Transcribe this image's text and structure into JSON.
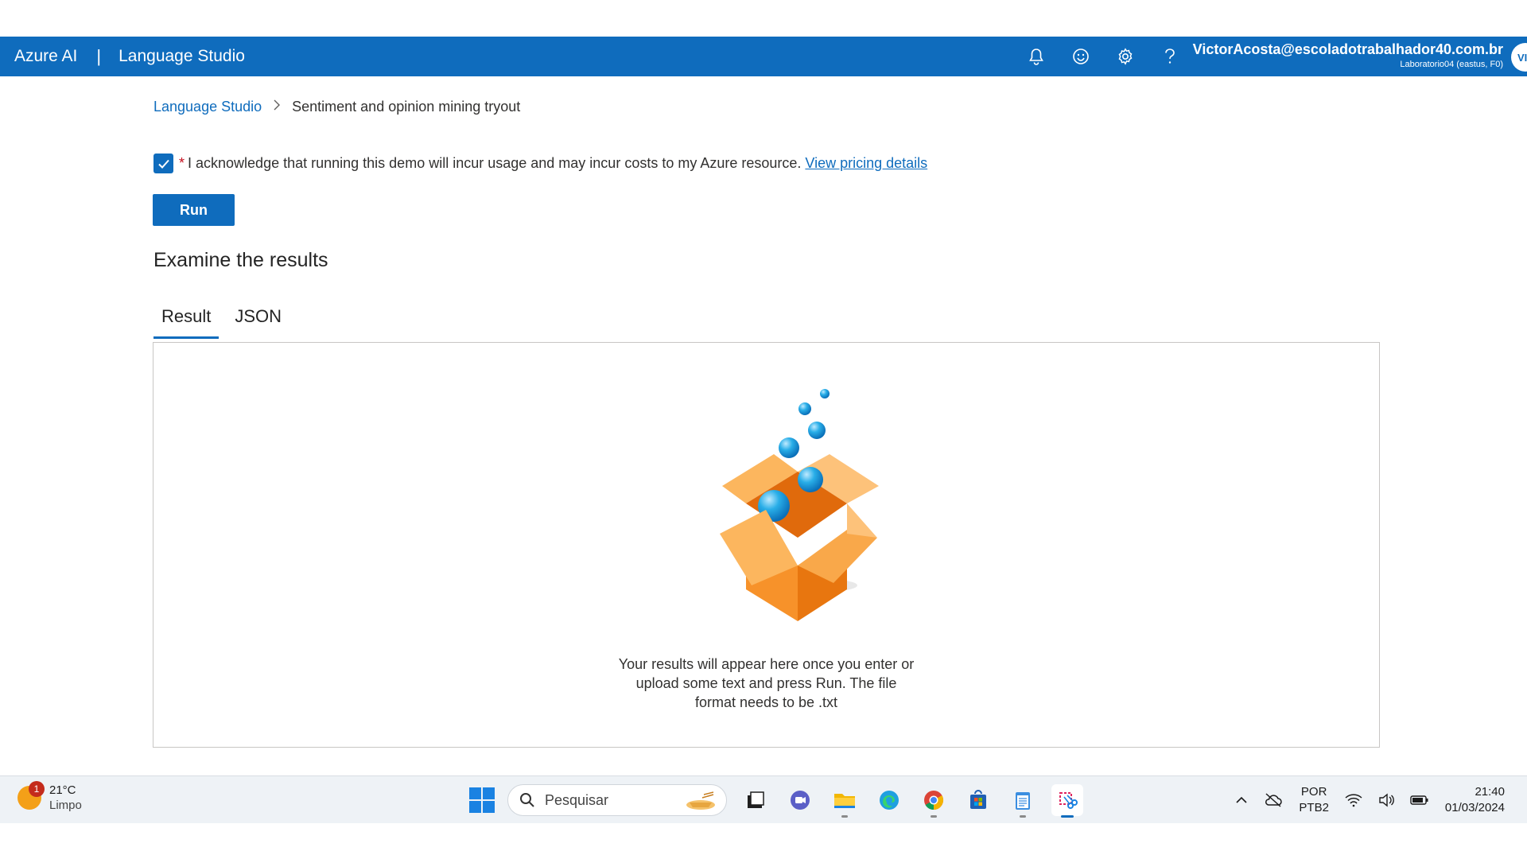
{
  "header": {
    "brand": "Azure AI",
    "separator": "|",
    "product": "Language Studio",
    "icons": [
      "bell-icon",
      "smiley-icon",
      "gear-icon",
      "help-icon"
    ],
    "user_email": "VictorAcosta@escoladotrabalhador40.com.br",
    "user_resource": "Laboratorio04 (eastus, F0)",
    "avatar_initials": "VI",
    "color": "#0f6cbd"
  },
  "breadcrumb": {
    "root": "Language Studio",
    "current": "Sentiment and opinion mining tryout"
  },
  "acknowledge": {
    "checked": true,
    "required_mark": "*",
    "text": "I acknowledge that running this demo will incur usage and may incur costs to my Azure resource.",
    "link": "View pricing details"
  },
  "run_label": "Run",
  "results": {
    "title": "Examine the results",
    "tabs": [
      {
        "label": "Result",
        "active": true
      },
      {
        "label": "JSON",
        "active": false
      }
    ],
    "empty_lines": [
      "Your results will appear here once you enter or",
      "upload some text and press Run. The file",
      "format needs to be .txt"
    ]
  },
  "taskbar": {
    "weather_temp": "21°C",
    "weather_desc": "Limpo",
    "weather_badge": "1",
    "search_placeholder": "Pesquisar",
    "apps": [
      "file-manager-icon",
      "teams-icon",
      "folder-icon",
      "edge-icon",
      "chrome-icon",
      "store-icon",
      "notepad-icon",
      "snipping-tool-icon"
    ],
    "lang_1": "POR",
    "lang_2": "PTB2",
    "time": "21:40",
    "date": "01/03/2024"
  }
}
